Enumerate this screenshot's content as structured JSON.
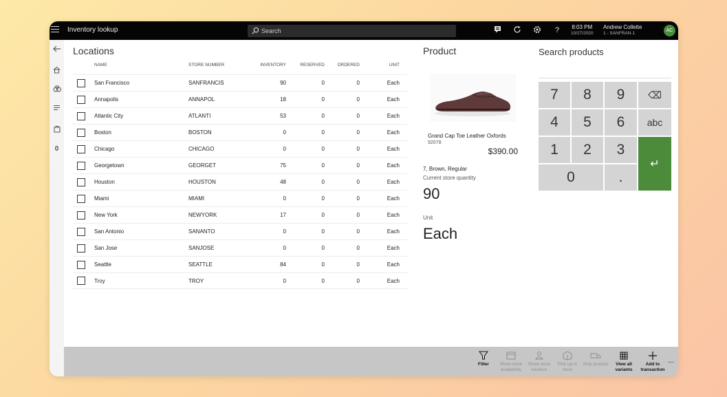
{
  "topbar": {
    "title": "Inventory lookup",
    "search_placeholder": "Search",
    "time": "8:03 PM",
    "date": "10/27/2020",
    "user_name": "Andrew Collette",
    "register": "1 - SANFRAN-1",
    "avatar_initials": "AC",
    "help_label": "?",
    "icons": [
      "menu-icon",
      "search-icon",
      "comment-icon",
      "refresh-icon",
      "settings-icon",
      "help-icon"
    ]
  },
  "rail": {
    "count_label": "0",
    "icons": [
      "back-arrow-icon",
      "home-icon",
      "products-icon",
      "list-icon",
      "bag-icon"
    ]
  },
  "locations": {
    "title": "Locations",
    "columns": [
      "NAME",
      "STORE NUMBER",
      "INVENTORY",
      "RESERVED",
      "ORDERED",
      "UNIT"
    ],
    "rows": [
      {
        "name": "San Francisco",
        "store": "SANFRANCIS",
        "inventory": "90",
        "reserved": "0",
        "ordered": "0",
        "unit": "Each"
      },
      {
        "name": "Annapolis",
        "store": "ANNAPOL",
        "inventory": "18",
        "reserved": "0",
        "ordered": "0",
        "unit": "Each"
      },
      {
        "name": "Atlantic City",
        "store": "ATLANTI",
        "inventory": "53",
        "reserved": "0",
        "ordered": "0",
        "unit": "Each"
      },
      {
        "name": "Boston",
        "store": "BOSTON",
        "inventory": "0",
        "reserved": "0",
        "ordered": "0",
        "unit": "Each"
      },
      {
        "name": "Chicago",
        "store": "CHICAGO",
        "inventory": "0",
        "reserved": "0",
        "ordered": "0",
        "unit": "Each"
      },
      {
        "name": "Georgetown",
        "store": "GEORGET",
        "inventory": "75",
        "reserved": "0",
        "ordered": "0",
        "unit": "Each"
      },
      {
        "name": "Houston",
        "store": "HOUSTON",
        "inventory": "48",
        "reserved": "0",
        "ordered": "0",
        "unit": "Each"
      },
      {
        "name": "Miami",
        "store": "MIAMI",
        "inventory": "0",
        "reserved": "0",
        "ordered": "0",
        "unit": "Each"
      },
      {
        "name": "New York",
        "store": "NEWYORK",
        "inventory": "17",
        "reserved": "0",
        "ordered": "0",
        "unit": "Each"
      },
      {
        "name": "San Antonio",
        "store": "SANANTO",
        "inventory": "0",
        "reserved": "0",
        "ordered": "0",
        "unit": "Each"
      },
      {
        "name": "San Jose",
        "store": "SANJOSE",
        "inventory": "0",
        "reserved": "0",
        "ordered": "0",
        "unit": "Each"
      },
      {
        "name": "Seattle",
        "store": "SEATTLE",
        "inventory": "84",
        "reserved": "0",
        "ordered": "0",
        "unit": "Each"
      },
      {
        "name": "Troy",
        "store": "TROY",
        "inventory": "0",
        "reserved": "0",
        "ordered": "0",
        "unit": "Each"
      }
    ]
  },
  "product": {
    "title": "Product",
    "name": "Grand Cap Toe Leather Oxfords",
    "id": "92078",
    "price": "$390.00",
    "variant": "7, Brown, Regular",
    "qty_label": "Current store quantity",
    "qty_value": "90",
    "unit_label": "Unit",
    "unit_value": "Each"
  },
  "numpad": {
    "title": "Search products",
    "keys": {
      "k7": "7",
      "k8": "8",
      "k9": "9",
      "backspace": "⌫",
      "k4": "4",
      "k5": "5",
      "k6": "6",
      "abc": "abc",
      "k1": "1",
      "k2": "2",
      "k3": "3",
      "enter": "↵",
      "k0": "0",
      "dot": "."
    }
  },
  "actions": [
    {
      "label": "Filter",
      "icon": "filter-icon",
      "enabled": true
    },
    {
      "label": "Show store availability",
      "icon": "calendar-icon",
      "enabled": false
    },
    {
      "label": "Show store location",
      "icon": "location-icon",
      "enabled": false
    },
    {
      "label": "Pick up in store",
      "icon": "box-icon",
      "enabled": false
    },
    {
      "label": "Ship product",
      "icon": "truck-icon",
      "enabled": false
    },
    {
      "label": "View all variants",
      "icon": "grid-icon",
      "enabled": true
    },
    {
      "label": "Add to transaction",
      "icon": "plus-icon",
      "enabled": true
    }
  ],
  "more_label": "..."
}
